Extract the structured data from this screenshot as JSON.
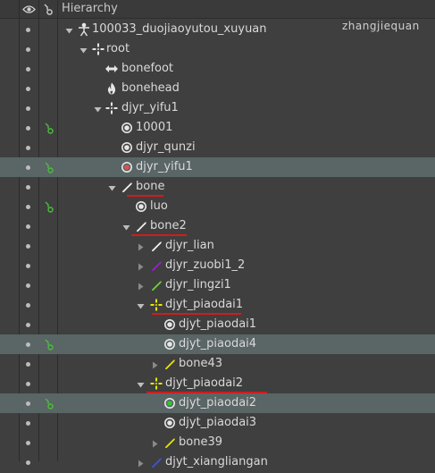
{
  "header": {
    "title": "Hierarchy",
    "eye_icon": "eye-icon",
    "link_icon": "link-icon"
  },
  "watermark": "zhangjiequan",
  "colors": {
    "selection": "#5a6565",
    "link_green": "#4bbf3c",
    "underline_red": "#d01c1c"
  },
  "rows": [
    {
      "label": "100033_duojiaoyutou_xuyuan",
      "icon": "skeleton-figure-icon",
      "expanded": true
    },
    {
      "label": "root",
      "icon": "crosshair-icon",
      "expanded": true
    },
    {
      "label": "bonefoot",
      "icon": "double-arrow-icon"
    },
    {
      "label": "bonehead",
      "icon": "flame-icon"
    },
    {
      "label": "djyr_yifu1",
      "icon": "crosshair-icon",
      "expanded": true
    },
    {
      "label": "10001",
      "icon": "radio-icon",
      "linked": true
    },
    {
      "label": "djyr_qunzi",
      "icon": "radio-icon"
    },
    {
      "label": "djyr_yifu1",
      "icon": "radio-red-icon",
      "linked": true,
      "selected": true
    },
    {
      "label": "bone",
      "icon": "bone-white-icon",
      "expanded": true,
      "underlined": true
    },
    {
      "label": "luo",
      "icon": "radio-icon",
      "linked": true
    },
    {
      "label": "bone2",
      "icon": "bone-white-icon",
      "expanded": true,
      "underlined": true
    },
    {
      "label": "djyr_lian",
      "icon": "bone-white-icon",
      "collapsed": true
    },
    {
      "label": "djyr_zuobi1_2",
      "icon": "bone-purple-icon",
      "collapsed": true
    },
    {
      "label": "djyr_lingzi1",
      "icon": "bone-green-icon",
      "collapsed": true
    },
    {
      "label": "djyt_piaodai1",
      "icon": "crosshair-yellow-icon",
      "expanded": true,
      "underlined": true
    },
    {
      "label": "djyt_piaodai1",
      "icon": "radio-icon"
    },
    {
      "label": "djyt_piaodai4",
      "icon": "radio-icon",
      "linked": true,
      "selected": true
    },
    {
      "label": "bone43",
      "icon": "bone-yellow-icon",
      "collapsed": true
    },
    {
      "label": "djyt_piaodai2",
      "icon": "crosshair-yellow-icon",
      "expanded": true,
      "underlined": true
    },
    {
      "label": "djyt_piaodai2",
      "icon": "radio-green-icon",
      "linked": true,
      "selected": true
    },
    {
      "label": "djyt_piaodai3",
      "icon": "radio-icon"
    },
    {
      "label": "bone39",
      "icon": "bone-yellow-icon",
      "collapsed": true
    },
    {
      "label": "djyt_xiangliangan",
      "icon": "bone-blue-icon",
      "collapsed": true
    }
  ]
}
